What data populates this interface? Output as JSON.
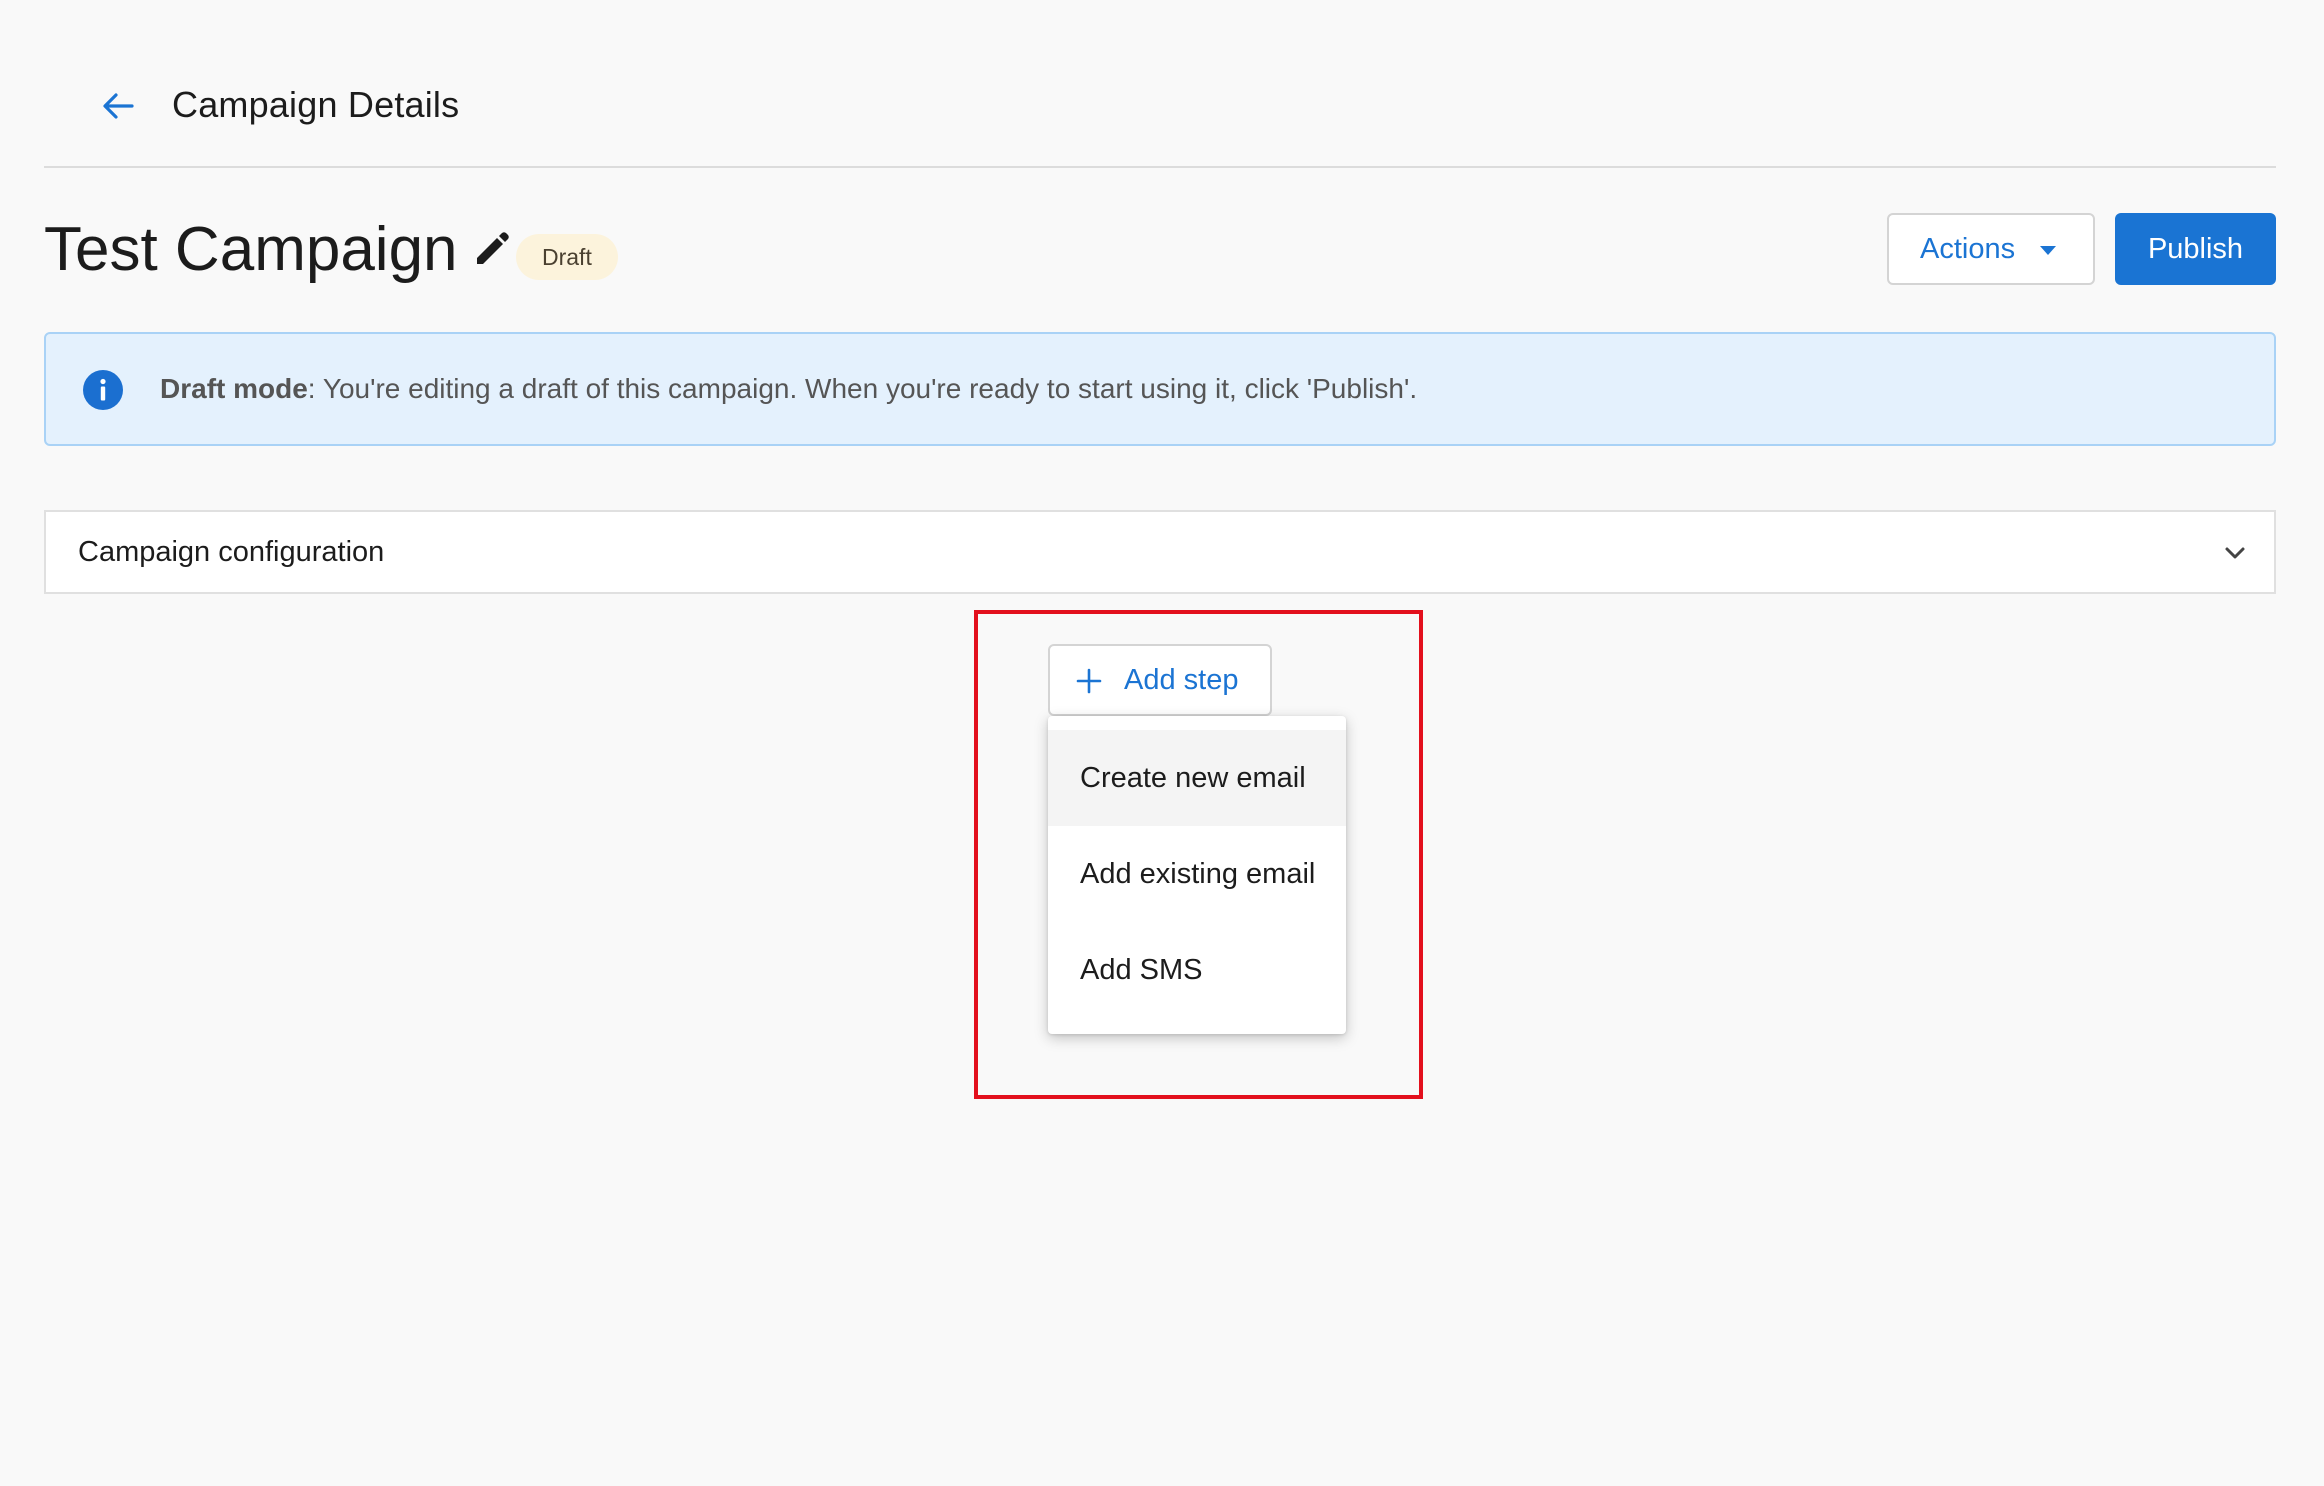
{
  "header": {
    "title": "Campaign Details"
  },
  "campaign": {
    "name": "Test Campaign",
    "status": "Draft"
  },
  "toolbar": {
    "actions_label": "Actions",
    "publish_label": "Publish"
  },
  "banner": {
    "label": "Draft mode",
    "message": " : You're editing a draft of this campaign. When you're ready to start using it, click 'Publish'."
  },
  "config_section": {
    "label": "Campaign configuration"
  },
  "add_step": {
    "label": "Add step",
    "menu": [
      {
        "label": "Create new email",
        "hovered": true
      },
      {
        "label": "Add existing email",
        "hovered": false
      },
      {
        "label": "Add SMS",
        "hovered": false
      }
    ]
  },
  "colors": {
    "accent": "#1a74d3",
    "highlight": "#e3101d",
    "badge_bg": "#fcf3dc",
    "banner_bg": "#e4f1fd"
  }
}
